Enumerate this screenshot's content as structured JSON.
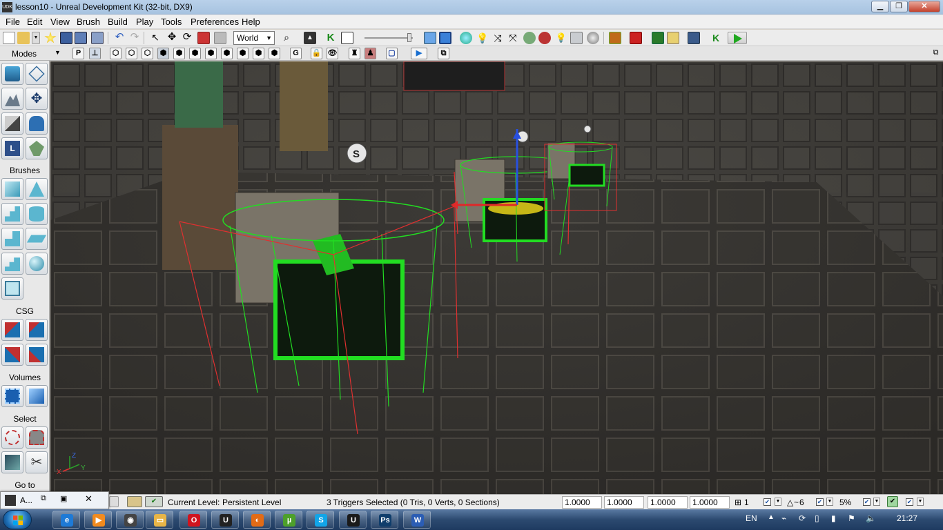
{
  "window": {
    "title": "lesson10 - Unreal Development Kit (32-bit, DX9)",
    "app_icon": "UDK",
    "controls": [
      "minimize-icon",
      "maximize-icon",
      "close-icon"
    ]
  },
  "menu": [
    "File",
    "Edit",
    "View",
    "Brush",
    "Build",
    "Play",
    "Tools",
    "Preferences",
    "Help"
  ],
  "toolbar": {
    "coordinate_system": "World",
    "icons": [
      "new-icon",
      "open-icon",
      "favorites-icon",
      "save-icon",
      "save-all-icon",
      "undo-icon",
      "redo-icon",
      "select-icon",
      "translate-icon",
      "rotate-icon",
      "scale-icon",
      "search-icon",
      "kismet-icon",
      "content-browser-icon",
      "build-geometry-icon",
      "build-lighting-icon",
      "build-paths-icon",
      "build-all-icon",
      "play-icon"
    ]
  },
  "viewport_toolbar": {
    "modes_label": "Modes",
    "perspective_button": "P",
    "game_view_button": "G",
    "view_mode_icons": [
      "wireframe-icon",
      "brush-wireframe-icon",
      "unlit-icon",
      "lit-icon",
      "detail-lighting-icon",
      "lighting-only-icon",
      "light-complexity-icon",
      "texture-density-icon",
      "shader-complexity-icon",
      "lightmap-density-icon"
    ],
    "realtime_icons": [
      "lock-icon",
      "show-flags-icon",
      "camera-icon",
      "actor-icon",
      "frame-icon",
      "play-in-viewport-icon"
    ]
  },
  "modes_panel": {
    "sections": [
      {
        "label": "Modes",
        "buttons": [
          "camera-mode-icon",
          "geometry-mode-icon",
          "terrain-mode-icon",
          "texture-mode-icon",
          "mesh-paint-icon",
          "static-mesh-icon",
          "landscape-icon",
          "foliage-icon"
        ]
      },
      {
        "label": "Brushes",
        "buttons": [
          "cube-brush-icon",
          "cone-brush-icon",
          "stairs-brush-icon",
          "cylinder-brush-icon",
          "linear-stairs-icon",
          "sheet-brush-icon",
          "spiral-stairs-icon",
          "sphere-brush-icon",
          "volumetric-brush-icon"
        ]
      },
      {
        "label": "CSG",
        "buttons": [
          "csg-add-icon",
          "csg-subtract-icon",
          "csg-intersect-icon",
          "csg-deintersect-icon"
        ]
      },
      {
        "label": "Volumes",
        "buttons": [
          "add-volume-icon",
          "volume-list-icon"
        ]
      },
      {
        "label": "Select",
        "buttons": [
          "show-selected-icon",
          "hide-selected-icon",
          "select-inside-icon",
          "invert-selection-icon"
        ]
      },
      {
        "label": "Go to",
        "buttons": []
      }
    ]
  },
  "viewport": {
    "axis_labels": {
      "x": "X",
      "y": "Y",
      "z": "Z"
    },
    "scene_colors": {
      "selection_green": "#22dd22",
      "bounds_red": "#e03030",
      "floor": "#2e2c29"
    }
  },
  "mini_window": {
    "label": "A..."
  },
  "status": {
    "current_level_label": "Current Level:",
    "current_level_value": "Persistent Level",
    "selection_info": "3 Triggers Selected (0 Tris, 0 Verts, 0 Sections)",
    "drag_grid_values": [
      "1.0000",
      "1.0000",
      "1.0000",
      "1.0000"
    ],
    "grid_size": "1",
    "rotation_snap": "6",
    "scale_snap": "5%"
  },
  "taskbar": {
    "start_icon": "windows-start-icon",
    "apps": [
      {
        "name": "ie-icon",
        "color": "#1e7ad6",
        "glyph": "e"
      },
      {
        "name": "media-player-icon",
        "color": "#f28b1e",
        "glyph": "▶"
      },
      {
        "name": "game-icon",
        "color": "#444444",
        "glyph": "◉"
      },
      {
        "name": "explorer-icon",
        "color": "#e8b547",
        "glyph": "▭"
      },
      {
        "name": "opera-icon",
        "color": "#d0141e",
        "glyph": "O"
      },
      {
        "name": "udk-icon",
        "color": "#222222",
        "glyph": "U"
      },
      {
        "name": "firefox-icon",
        "color": "#e26b16",
        "glyph": "◐"
      },
      {
        "name": "utorrent-icon",
        "color": "#4da02a",
        "glyph": "µ"
      },
      {
        "name": "skype-icon",
        "color": "#12a5e8",
        "glyph": "S"
      },
      {
        "name": "udk-editor-icon",
        "color": "#1a1a1a",
        "glyph": "U"
      },
      {
        "name": "photoshop-icon",
        "color": "#0f3d6b",
        "glyph": "Ps"
      },
      {
        "name": "word-icon",
        "color": "#2b5db4",
        "glyph": "W"
      }
    ],
    "language": "EN",
    "clock": "21:27"
  }
}
